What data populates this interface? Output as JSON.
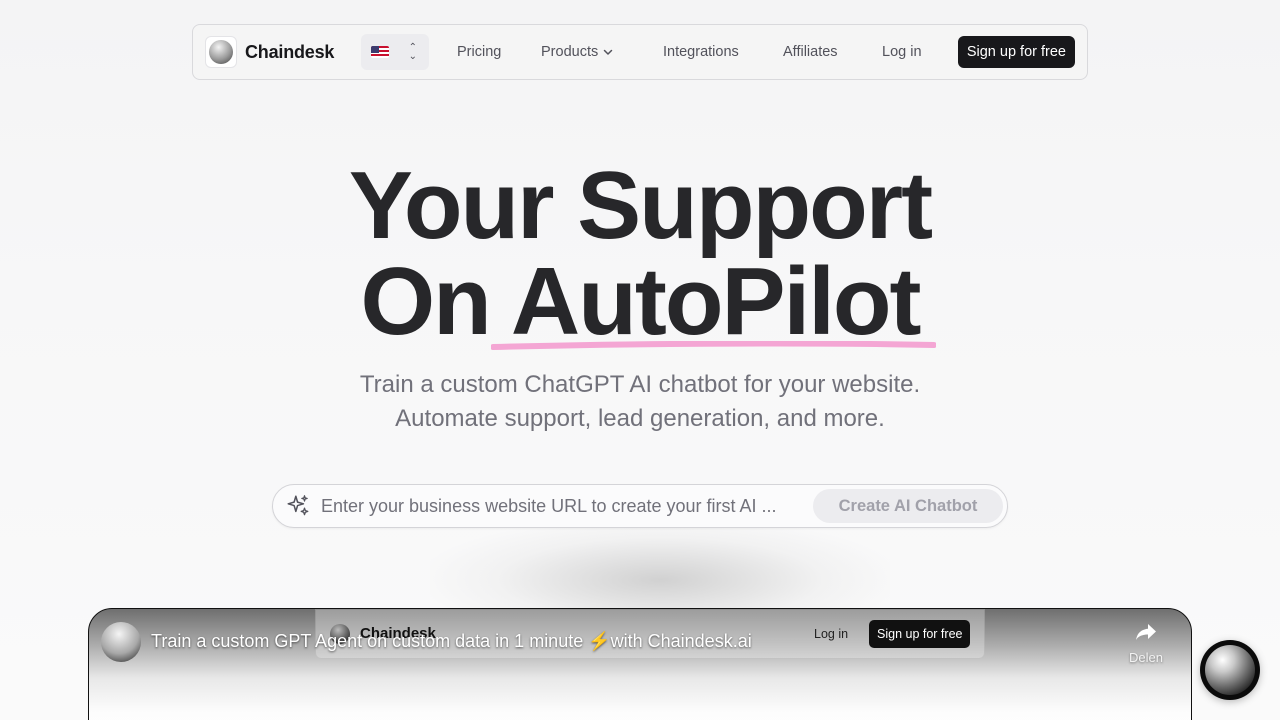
{
  "nav": {
    "brand": "Chaindesk",
    "language_flag": "🇺🇸",
    "links": {
      "pricing": "Pricing",
      "products": "Products",
      "integrations": "Integrations",
      "affiliates": "Affiliates",
      "login": "Log in"
    },
    "signup": "Sign up for free"
  },
  "hero": {
    "line1": "Your Support",
    "line2": "On AutoPilot",
    "subtitle_line1": "Train a custom ChatGPT AI chatbot for your website.",
    "subtitle_line2": "Automate support, lead generation, and more.",
    "underline_color": "#f4a6d4"
  },
  "cta": {
    "placeholder": "Enter your business website URL to create your first AI ...",
    "value": "",
    "button": "Create AI Chatbot"
  },
  "video": {
    "title": "Train a custom GPT Agent on custom data in 1 minute ⚡️with Chaindesk.ai",
    "share_label": "Delen",
    "inner_brand": "Chaindesk",
    "inner_login": "Log in",
    "inner_signup": "Sign up for free"
  },
  "colors": {
    "primary_dark": "#18181b",
    "text_muted": "#71717a",
    "accent_pink": "#f4a6d4"
  },
  "icons": {
    "sparkle": "sparkles-icon",
    "share": "share-arrow-icon",
    "chevron": "chevron-down-icon",
    "updown": "chevron-up-down-icon"
  }
}
